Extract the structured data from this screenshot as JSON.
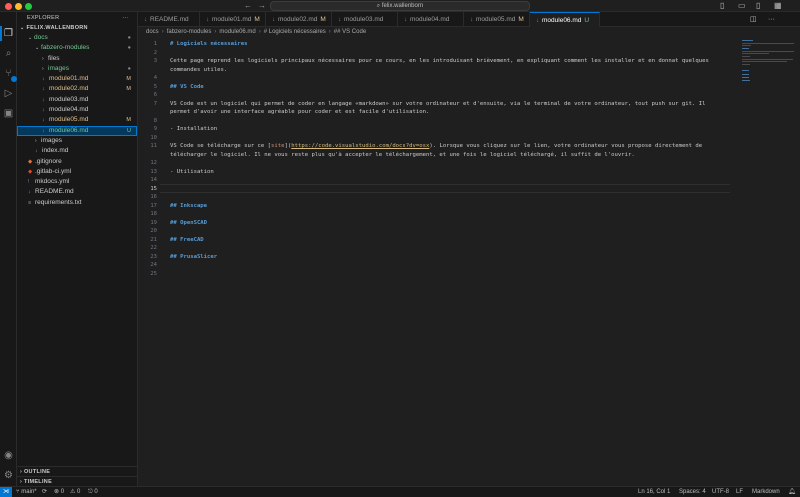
{
  "titlebar": {
    "search": "felix.wallenborn",
    "colors": {
      "close": "#ff5f57",
      "minimize": "#febc2e",
      "maximize": "#28c840"
    }
  },
  "sidebar": {
    "title": "EXPLORER",
    "more": "···",
    "root": "FELIX.WALLENBORN",
    "tree": [
      {
        "label": "docs",
        "type": "folder-open",
        "deco": "●",
        "status": "mod"
      },
      {
        "label": "fabzero-modules",
        "type": "folder-open",
        "deco": "●",
        "status": "mod"
      },
      {
        "label": "files",
        "type": "folder",
        "deco": "",
        "status": ""
      },
      {
        "label": "images",
        "type": "folder",
        "deco": "●",
        "status": "untracked"
      },
      {
        "label": "module01.md",
        "type": "md",
        "deco": "M",
        "status": "mod"
      },
      {
        "label": "module02.md",
        "type": "md",
        "deco": "M",
        "status": "mod"
      },
      {
        "label": "module03.md",
        "type": "md",
        "deco": "",
        "status": ""
      },
      {
        "label": "module04.md",
        "type": "md",
        "deco": "",
        "status": ""
      },
      {
        "label": "module05.md",
        "type": "md",
        "deco": "M",
        "status": "mod"
      },
      {
        "label": "module06.md",
        "type": "md",
        "deco": "U",
        "status": "untracked",
        "selected": true
      },
      {
        "label": "images",
        "type": "folder",
        "deco": "",
        "status": ""
      },
      {
        "label": "index.md",
        "type": "md",
        "deco": "",
        "status": ""
      },
      {
        "label": ".gitignore",
        "type": "git",
        "deco": "",
        "status": ""
      },
      {
        "label": ".gitlab-ci.yml",
        "type": "gitlab",
        "deco": "",
        "status": ""
      },
      {
        "label": "mkdocs.yml",
        "type": "yml",
        "deco": "",
        "status": ""
      },
      {
        "label": "README.md",
        "type": "md",
        "deco": "",
        "status": ""
      },
      {
        "label": "requirements.txt",
        "type": "txt",
        "deco": "",
        "status": ""
      }
    ],
    "outline": "OUTLINE",
    "timeline": "TIMELINE"
  },
  "tabs": [
    {
      "label": "README.md",
      "deco": ""
    },
    {
      "label": "module01.md",
      "deco": "M"
    },
    {
      "label": "module02.md",
      "deco": "M"
    },
    {
      "label": "module03.md",
      "deco": ""
    },
    {
      "label": "module04.md",
      "deco": ""
    },
    {
      "label": "module05.md",
      "deco": "M"
    },
    {
      "label": "module06.md",
      "deco": "U",
      "active": true
    }
  ],
  "breadcrumb": [
    "docs",
    "fabzero-modules",
    "module06.md",
    "# Logiciels nécessaires",
    "## VS Code"
  ],
  "editor": {
    "lines": [
      {
        "n": "1",
        "text": "# Logiciels nécessaires",
        "kind": "h"
      },
      {
        "n": "2",
        "text": "",
        "kind": ""
      },
      {
        "n": "3",
        "text": "Cette page reprend les logiciels principaux nécessaires pour ce cours, en les introduisant brièvement, en expliquant comment les installer et en donnat quelques",
        "kind": ""
      },
      {
        "n": "",
        "text": "commandes utiles.",
        "kind": ""
      },
      {
        "n": "4",
        "text": "",
        "kind": ""
      },
      {
        "n": "5",
        "text": "## VS Code",
        "kind": "h"
      },
      {
        "n": "6",
        "text": "",
        "kind": ""
      },
      {
        "n": "7",
        "text": "VS Code est un logiciel qui permet de coder en langage «markdown» sur votre ordinateur et d'ensuite, via le terminal de votre ordinateur, tout push sur git. Il",
        "kind": ""
      },
      {
        "n": "",
        "text": "permet d'avoir une interface agréable pour coder et est facile d'utilisation.",
        "kind": ""
      },
      {
        "n": "8",
        "text": "",
        "kind": ""
      },
      {
        "n": "9",
        "text": "- Installation",
        "kind": ""
      },
      {
        "n": "10",
        "text": "",
        "kind": ""
      },
      {
        "n": "11",
        "text": "VS Code se télécharge sur ce [site](https://code.visualstudio.com/docs?dv=osx). Lorsque vous cliquez sur le lien, votre ordinateur vous propose directement de",
        "kind": "link"
      },
      {
        "n": "",
        "text": "télécharger le logiciel. Il ne vous reste plus qu'à accepter le téléchargement, et une fois le logiciel téléchargé, il suffit de l'ouvrir.",
        "kind": ""
      },
      {
        "n": "12",
        "text": "",
        "kind": ""
      },
      {
        "n": "13",
        "text": "- Utilisation",
        "kind": ""
      },
      {
        "n": "14",
        "text": "",
        "kind": ""
      },
      {
        "n": "15",
        "text": "",
        "kind": "",
        "current": true
      },
      {
        "n": "16",
        "text": "",
        "kind": ""
      },
      {
        "n": "17",
        "text": "## Inkscape",
        "kind": "h"
      },
      {
        "n": "18",
        "text": "",
        "kind": ""
      },
      {
        "n": "19",
        "text": "## OpenSCAD",
        "kind": "h"
      },
      {
        "n": "20",
        "text": "",
        "kind": ""
      },
      {
        "n": "21",
        "text": "## FreeCAD",
        "kind": "h"
      },
      {
        "n": "22",
        "text": "",
        "kind": ""
      },
      {
        "n": "23",
        "text": "## PrusaSlicer",
        "kind": "h"
      },
      {
        "n": "24",
        "text": "",
        "kind": ""
      },
      {
        "n": "25",
        "text": "",
        "kind": ""
      }
    ],
    "link_parts": {
      "before": "VS Code se télécharge sur ce [",
      "word": "site",
      "mid": "](",
      "url": "https://code.visualstudio.com/docs?dv=osx",
      "after": "). Lorsque vous cliquez sur le lien, votre ordinateur vous propose directement de"
    }
  },
  "statusbar": {
    "branch": "main*",
    "sync": "⟳",
    "errors": "⊗ 0",
    "warnings": "⚠ 0",
    "ports": "0",
    "position": "Ln 16, Col 1",
    "spaces": "Spaces: 4",
    "encoding": "UTF-8",
    "eol": "LF",
    "language": "Markdown"
  }
}
